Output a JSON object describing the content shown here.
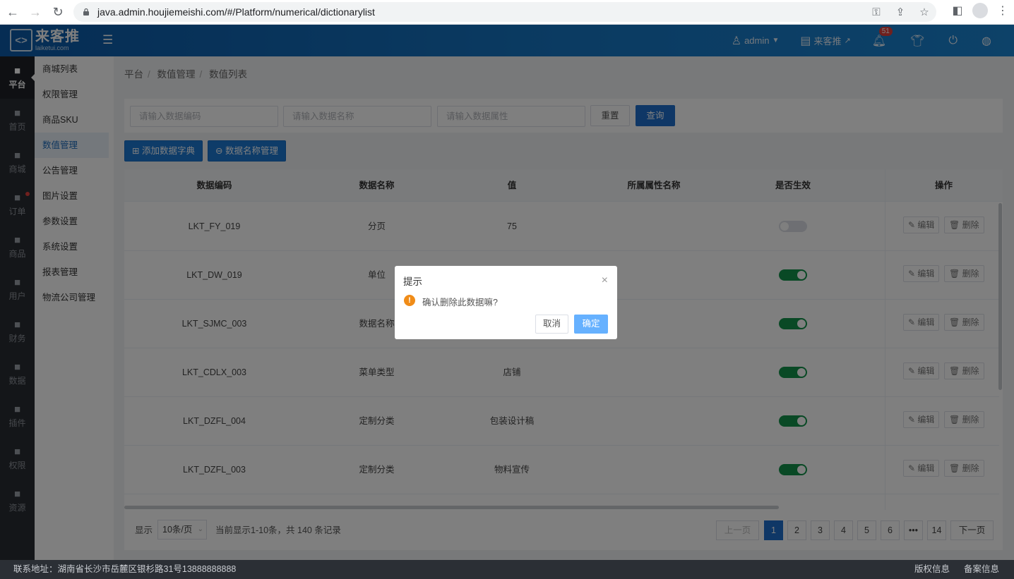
{
  "browser": {
    "url": "java.admin.houjiemeishi.com/#/Platform/numerical/dictionarylist"
  },
  "header": {
    "logo_name": "来客推",
    "logo_domain": "laiketui.com",
    "user": "admin",
    "store": "来客推",
    "notification_count": "51"
  },
  "leftnav": [
    {
      "label": "平台",
      "icon": "platform-icon",
      "active": true
    },
    {
      "label": "首页",
      "icon": "home-icon"
    },
    {
      "label": "商城",
      "icon": "mall-icon"
    },
    {
      "label": "订单",
      "icon": "order-icon",
      "dot": true
    },
    {
      "label": "商品",
      "icon": "goods-icon"
    },
    {
      "label": "用户",
      "icon": "user-icon"
    },
    {
      "label": "财务",
      "icon": "finance-icon"
    },
    {
      "label": "数据",
      "icon": "data-icon"
    },
    {
      "label": "插件",
      "icon": "plugin-icon"
    },
    {
      "label": "权限",
      "icon": "permission-icon"
    },
    {
      "label": "资源",
      "icon": "resource-icon"
    }
  ],
  "submenu": [
    "商城列表",
    "权限管理",
    "商品SKU",
    "数值管理",
    "公告管理",
    "图片设置",
    "参数设置",
    "系统设置",
    "报表管理",
    "物流公司管理"
  ],
  "breadcrumb": [
    "平台",
    "数值管理",
    "数值列表"
  ],
  "filter": {
    "code_placeholder": "请输入数据编码",
    "name_placeholder": "请输入数据名称",
    "attr_placeholder": "请输入数据属性",
    "reset_label": "重置",
    "query_label": "查询"
  },
  "actions": {
    "add_label": "添加数据字典",
    "manage_label": "数据名称管理"
  },
  "table": {
    "headers": [
      "数据编码",
      "数据名称",
      "值",
      "所属属性名称",
      "是否生效",
      "操作"
    ],
    "edit_label": "编辑",
    "delete_label": "删除",
    "rows": [
      {
        "code": "LKT_FY_019",
        "name": "分页",
        "value": "75",
        "attr": "",
        "active": false
      },
      {
        "code": "LKT_DW_019",
        "name": "单位",
        "value": "",
        "attr": "",
        "active": true
      },
      {
        "code": "LKT_SJMC_003",
        "name": "数据名称",
        "value": "",
        "attr": "",
        "active": true
      },
      {
        "code": "LKT_CDLX_003",
        "name": "菜单类型",
        "value": "店铺",
        "attr": "",
        "active": true
      },
      {
        "code": "LKT_DZFL_004",
        "name": "定制分类",
        "value": "包装设计稿",
        "attr": "",
        "active": true
      },
      {
        "code": "LKT_DZFL_003",
        "name": "定制分类",
        "value": "物料宣传",
        "attr": "",
        "active": true
      }
    ]
  },
  "pager": {
    "show_label": "显示",
    "page_size": "10条/页",
    "summary": "当前显示1-10条，共 140 条记录",
    "prev": "上一页",
    "next": "下一页",
    "pages": [
      "1",
      "2",
      "3",
      "4",
      "5",
      "6",
      "•••",
      "14"
    ],
    "current": "1"
  },
  "footer": {
    "address": "联系地址：湖南省长沙市岳麓区银杉路31号13888888888",
    "copyright": "版权信息",
    "icp": "备案信息"
  },
  "dialog": {
    "title": "提示",
    "message": "确认删除此数据嘛?",
    "cancel": "取消",
    "confirm": "确定"
  }
}
